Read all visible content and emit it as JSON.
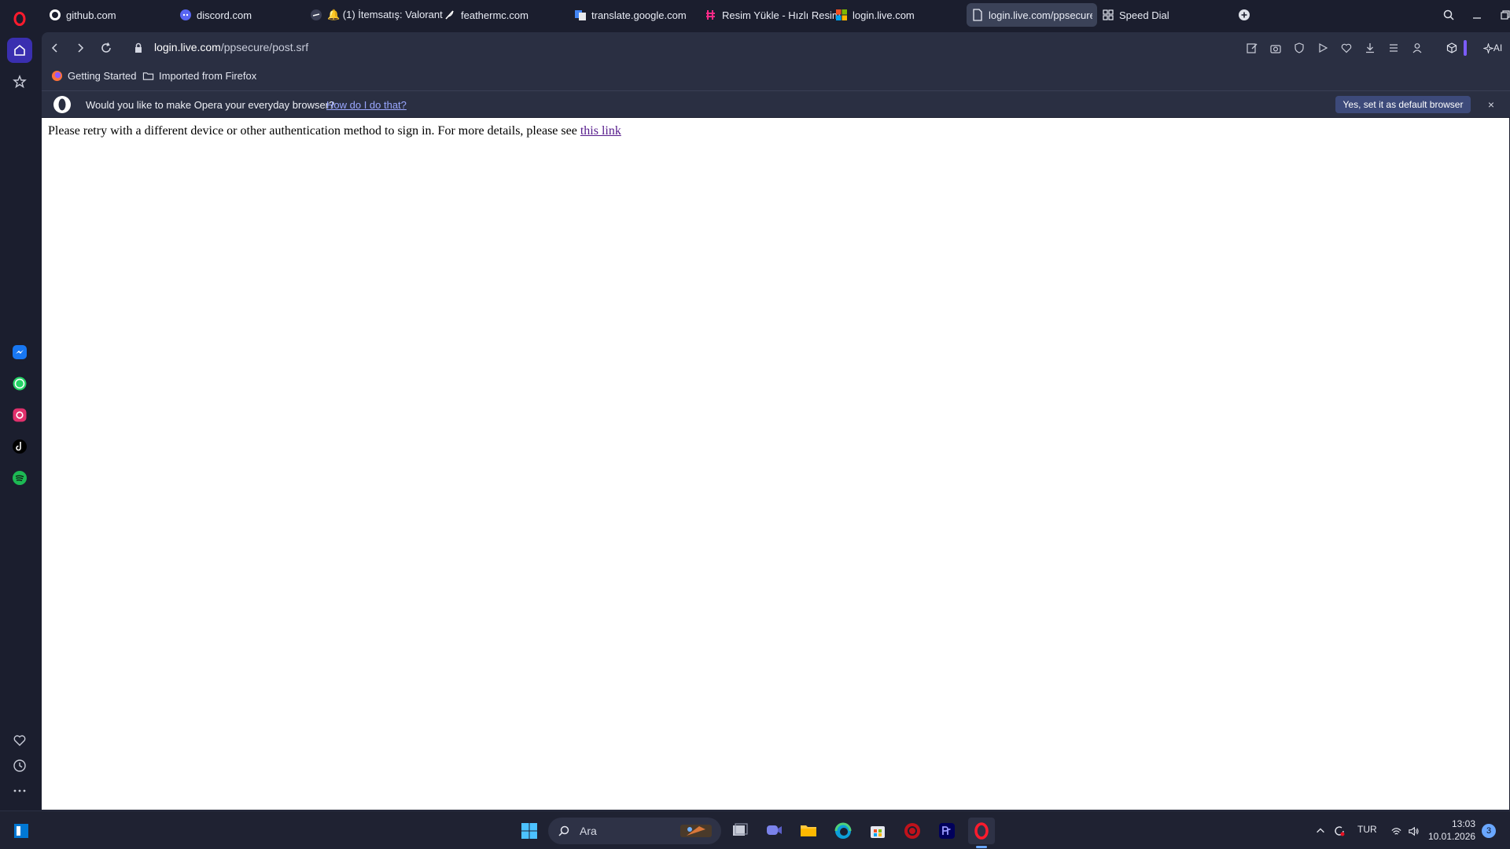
{
  "browser": {
    "accent": "#7b5cff",
    "brand_red": "#ff1b2d"
  },
  "tabs": [
    {
      "label": "github.com",
      "icon": "github-icon"
    },
    {
      "label": "discord.com",
      "icon": "discord-icon"
    },
    {
      "label": "🔔 (1) İtemsatış: Valorant",
      "icon": "link-icon"
    },
    {
      "label": "feathermc.com",
      "icon": "feather-icon"
    },
    {
      "label": "translate.google.com",
      "icon": "translate-icon"
    },
    {
      "label": "Resim Yükle - Hızlı Resim",
      "icon": "image-host-icon"
    },
    {
      "label": "login.live.com",
      "icon": "microsoft-icon"
    },
    {
      "label": "login.live.com/ppsecure/p",
      "icon": "page-icon"
    },
    {
      "label": "Speed Dial",
      "icon": "grid-icon"
    }
  ],
  "address": {
    "domain": "login.live.com",
    "path": "/ppsecure/post.srf"
  },
  "bookmarks": [
    {
      "label": "Getting Started",
      "icon": "firefox-icon"
    },
    {
      "label": "Imported from Firefox",
      "icon": "folder-icon"
    }
  ],
  "infobar": {
    "text": "Would you like to make Opera your everyday browser?",
    "link": "How do I do that?",
    "button": "Yes, set it as default browser",
    "close": "×"
  },
  "page": {
    "message": "Please retry with a different device or other authentication method to sign in. For more details, please see ",
    "link": "this link"
  },
  "toolbar": {
    "ai_label": "AI"
  },
  "taskbar": {
    "search_placeholder": "Ara",
    "language": "TUR",
    "time": "13:03",
    "date": "10.01.2026",
    "notification_count": "3"
  }
}
